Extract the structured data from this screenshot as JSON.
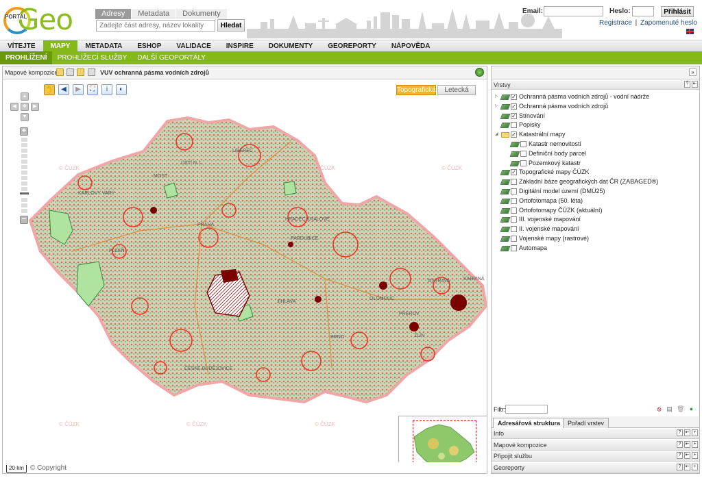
{
  "header": {
    "logo_small": "PORTAL",
    "logo_big": "Geo",
    "search_tabs": [
      "Adresy",
      "Metadata",
      "Dokumenty"
    ],
    "search_placeholder": "Zadejte část adresy, název lokality",
    "search_button": "Hledat",
    "email_label": "Email:",
    "password_label": "Heslo:",
    "login_button": "Přihlásit",
    "register_link": "Registrace",
    "separator": "|",
    "forgot_link": "Zapomenuté heslo"
  },
  "main_nav": [
    "VÍTEJTE",
    "MAPY",
    "METADATA",
    "ESHOP",
    "VALIDACE",
    "INSPIRE",
    "DOKUMENTY",
    "GEOREPORTY",
    "NÁPOVĚDA"
  ],
  "sub_nav": [
    "PROHLÍŽENÍ",
    "PROHLÍŽECÍ SLUŽBY",
    "DALŠÍ GEOPORTÁLY"
  ],
  "map": {
    "toolbar_label": "Mapové kompozice:",
    "composition_title": "VUV ochranná pásma vodních zdrojů",
    "base_layers": [
      "Topografická",
      "Letecká"
    ],
    "watermark": "© ČÚZK",
    "scale": "20 km",
    "copyright": "© Copyright",
    "cities": [
      "PRAHA",
      "PLZEŇ",
      "BRNO",
      "OSTRAVA",
      "HRADEC KRÁLOVÉ",
      "PARDUBICE",
      "OLOMOUC",
      "ZLÍN",
      "KARLOVY VARY",
      "MOST",
      "LIBEREC",
      "JIHLAVA",
      "ÚSTÍ N. L.",
      "KARVINÁ",
      "PŘEROV",
      "ČESKÉ BUDĚJOVICE"
    ]
  },
  "layers_panel": {
    "title": "Vrstvy",
    "layers": [
      {
        "label": "Ochranná pásma vodních zdrojů - vodní nádrže",
        "checked": true,
        "expander": "▷",
        "indent": 0
      },
      {
        "label": "Ochranná pásma vodních zdrojů",
        "checked": true,
        "expander": "▷",
        "indent": 0
      },
      {
        "label": "Stínování",
        "checked": true,
        "expander": "",
        "indent": 0
      },
      {
        "label": "Popisky",
        "checked": false,
        "expander": "",
        "indent": 0
      },
      {
        "label": "Katastrální mapy",
        "checked": true,
        "expander": "◢",
        "indent": 0,
        "folder": true
      },
      {
        "label": "Katastr nemovitostí",
        "checked": false,
        "expander": "",
        "indent": 1
      },
      {
        "label": "Definiční body parcel",
        "checked": false,
        "expander": "",
        "indent": 1
      },
      {
        "label": "Pozemkový katastr",
        "checked": false,
        "expander": "",
        "indent": 1
      },
      {
        "label": "Topografické mapy ČÚZK",
        "checked": true,
        "expander": "",
        "indent": 0
      },
      {
        "label": "Základní báze geografických dat ČR (ZABAGED®)",
        "checked": false,
        "expander": "",
        "indent": 0
      },
      {
        "label": "Digitální model území (DMÚ25)",
        "checked": false,
        "expander": "",
        "indent": 0
      },
      {
        "label": "Ortofotomapa (50. léta)",
        "checked": false,
        "expander": "",
        "indent": 0
      },
      {
        "label": "Ortofotomapy ČÚZK (aktuální)",
        "checked": false,
        "expander": "",
        "indent": 0
      },
      {
        "label": "III. vojenské mapování",
        "checked": false,
        "expander": "",
        "indent": 0
      },
      {
        "label": "II. vojenské mapování",
        "checked": false,
        "expander": "",
        "indent": 0
      },
      {
        "label": "Vojenské mapy (rastrové)",
        "checked": false,
        "expander": "",
        "indent": 0
      },
      {
        "label": "Automapa",
        "checked": false,
        "expander": "",
        "indent": 0
      }
    ],
    "filter_label": "Filtr:",
    "tabs": [
      "Adresářová struktura",
      "Pořadí vrstev"
    ],
    "sections": [
      "Info",
      "Mapové kompozice",
      "Připojit službu",
      "Georeporty"
    ],
    "section_buttons": [
      "?",
      "⇤",
      "+"
    ]
  }
}
